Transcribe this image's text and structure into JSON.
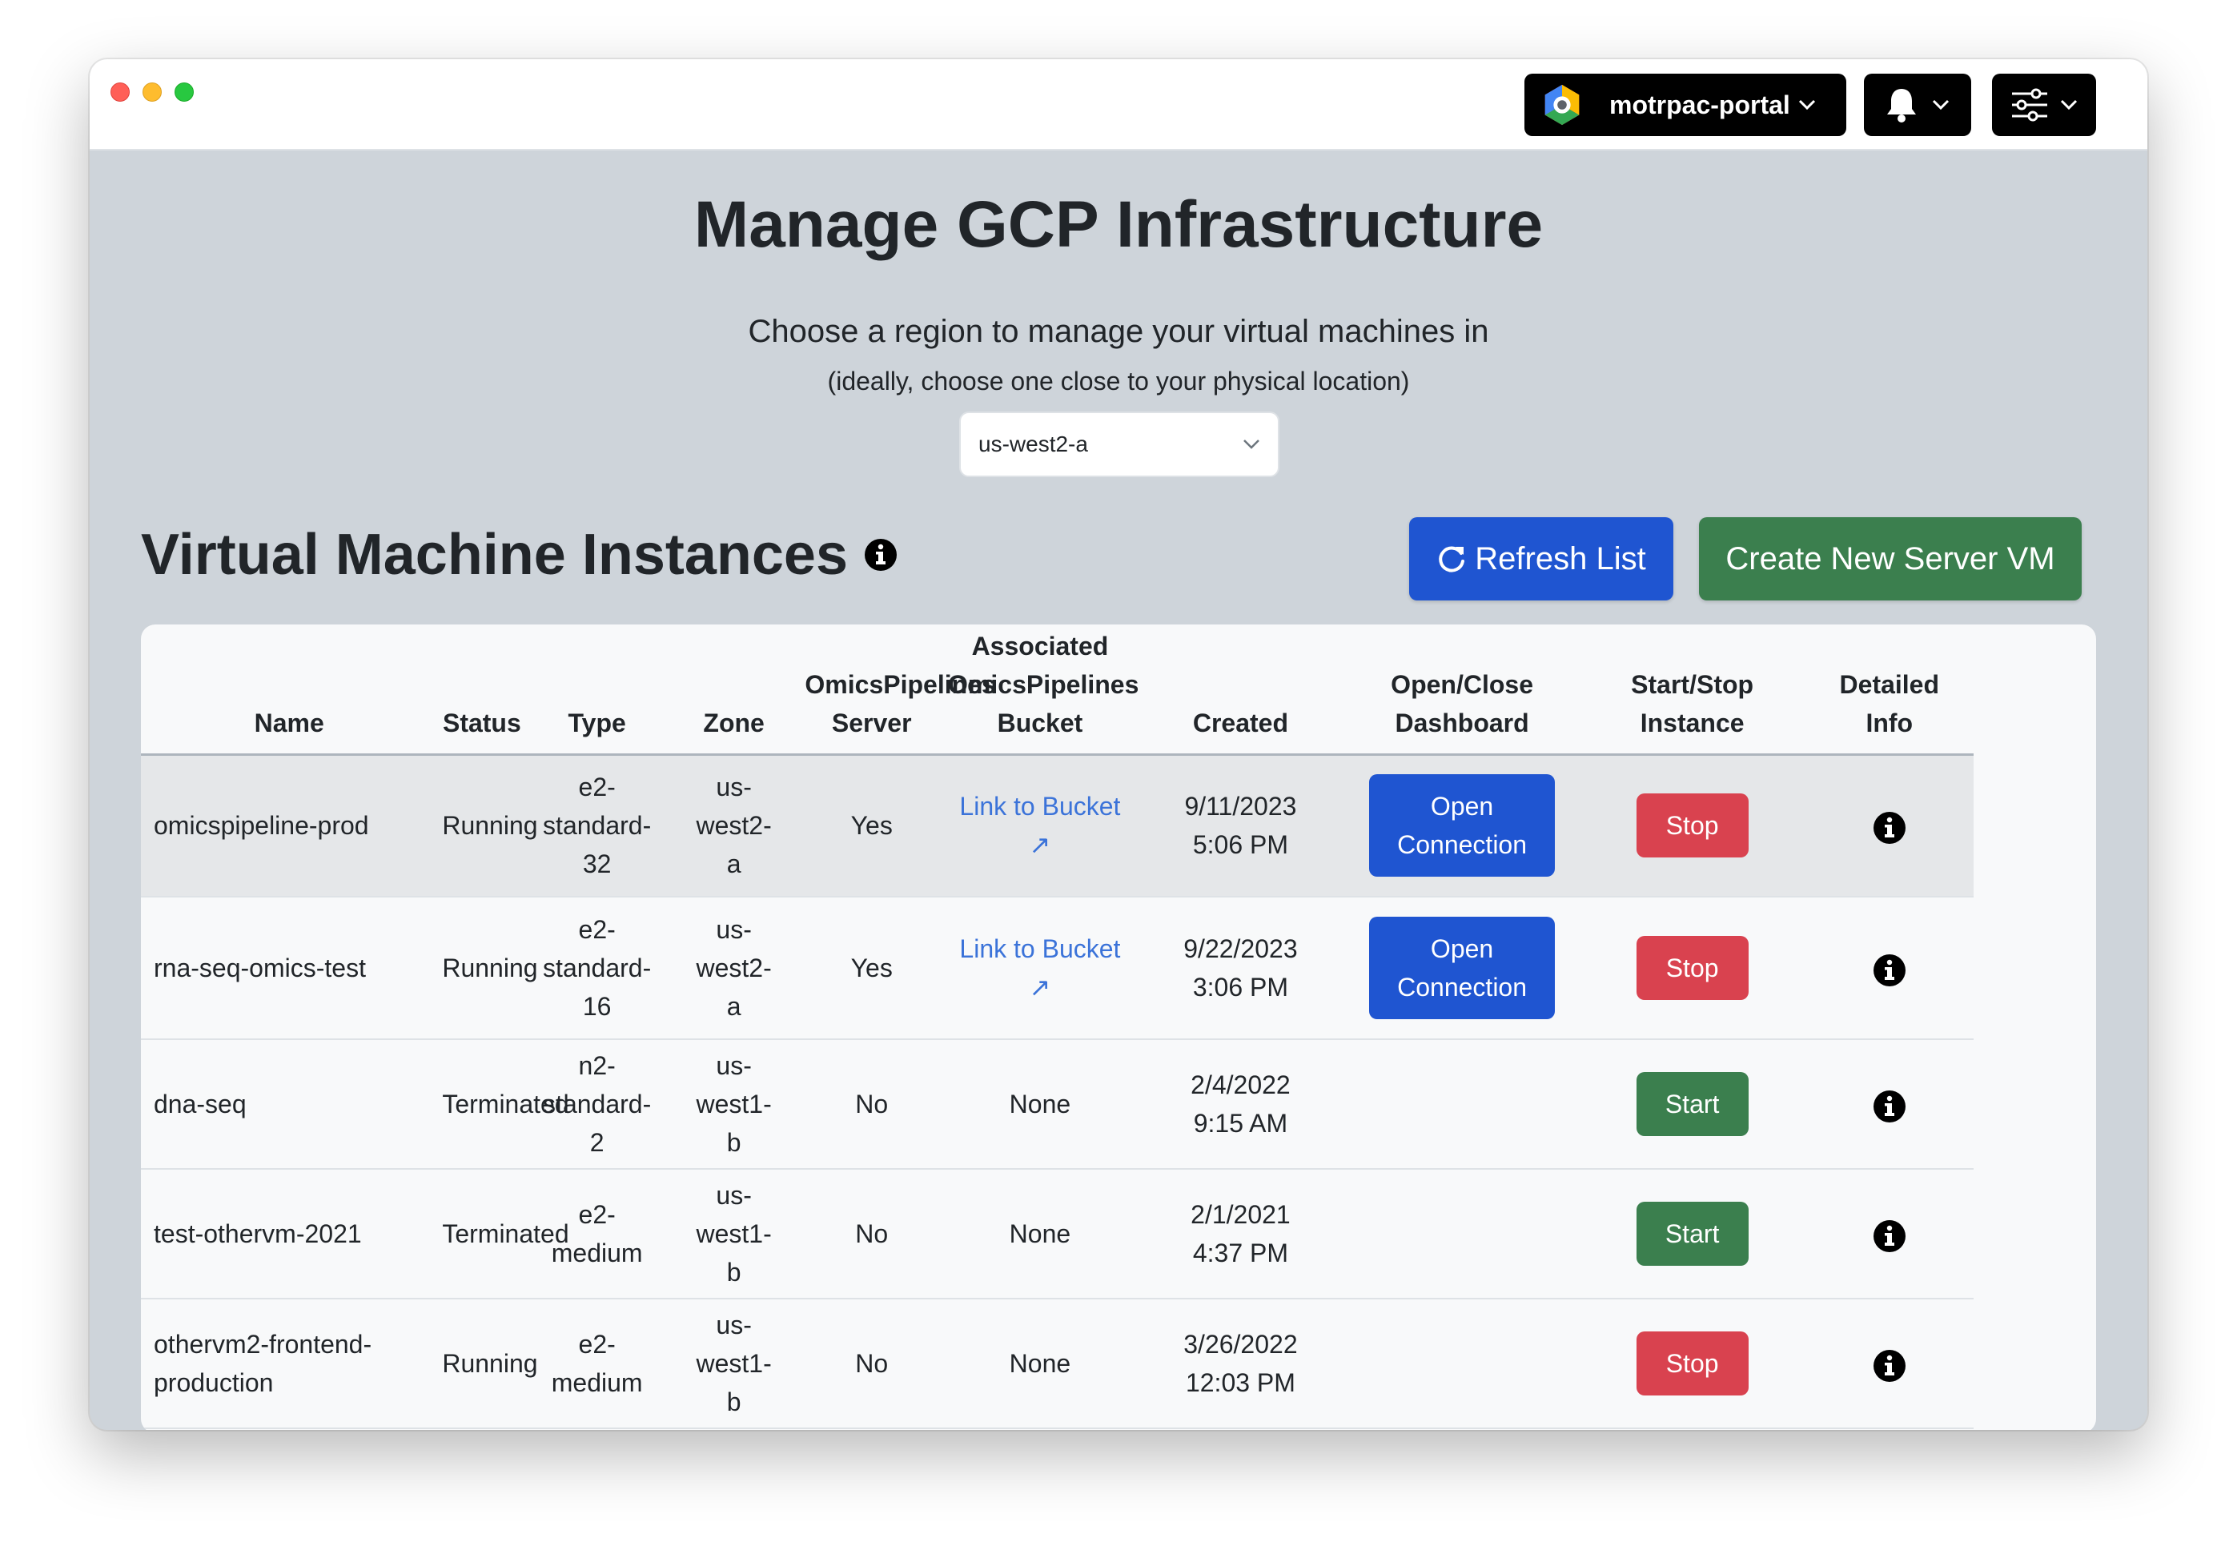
{
  "header": {
    "project_name": "motrpac-portal",
    "icons": [
      "gcp-logo-icon",
      "bell-icon",
      "sliders-icon",
      "chevron-down-icon"
    ]
  },
  "page": {
    "title": "Manage GCP Infrastructure",
    "region_prompt": "Choose a region to manage your virtual machines in",
    "region_hint": "(ideally, choose one close to your physical location)",
    "region_selected": "us-west2-a"
  },
  "section": {
    "title": "Virtual Machine Instances",
    "refresh_label": "Refresh List",
    "create_label": "Create New Server VM"
  },
  "table": {
    "headers": {
      "name": "Name",
      "status": "Status",
      "type": "Type",
      "zone": "Zone",
      "server_l1": "OmicsPipelines",
      "server_l2": "Server",
      "bucket_l1": "Associated",
      "bucket_l2": "OmicsPipelines",
      "bucket_l3": "Bucket",
      "created": "Created",
      "dash_l1": "Open/Close",
      "dash_l2": "Dashboard",
      "ss_l1": "Start/Stop",
      "ss_l2": "Instance",
      "info_l1": "Detailed",
      "info_l2": "Info"
    },
    "rows": [
      {
        "name": "omicspipeline-prod",
        "status": "Running",
        "type_l1": "e2-",
        "type_l2": "standard-",
        "type_l3": "32",
        "zone_l1": "us-",
        "zone_l2": "west2-",
        "zone_l3": "a",
        "server": "Yes",
        "bucket": "Link to Bucket ↗",
        "created_date": "9/11/2023",
        "created_time": "5:06 PM",
        "dash_l1": "Open",
        "dash_l2": "Connection",
        "action": "Stop",
        "action_color": "#d9424f"
      },
      {
        "name": "rna-seq-omics-test",
        "status": "Running",
        "type_l1": "e2-",
        "type_l2": "standard-",
        "type_l3": "16",
        "zone_l1": "us-",
        "zone_l2": "west2-",
        "zone_l3": "a",
        "server": "Yes",
        "bucket": "Link to Bucket ↗",
        "created_date": "9/22/2023",
        "created_time": "3:06 PM",
        "dash_l1": "Open",
        "dash_l2": "Connection",
        "action": "Stop",
        "action_color": "#d9424f"
      },
      {
        "name": "dna-seq",
        "status": "Terminated",
        "type_l1": "n2-",
        "type_l2": "standard-",
        "type_l3": "2",
        "zone_l1": "us-",
        "zone_l2": "west1-",
        "zone_l3": "b",
        "server": "No",
        "bucket": "None",
        "created_date": "2/4/2022",
        "created_time": "9:15 AM",
        "action": "Start",
        "action_color": "#3b7f4e"
      },
      {
        "name": "test-othervm-2021",
        "status": "Terminated",
        "type_l1": "e2-",
        "type_l2": "medium",
        "zone_l1": "us-",
        "zone_l2": "west1-",
        "zone_l3": "b",
        "server": "No",
        "bucket": "None",
        "created_date": "2/1/2021",
        "created_time": "4:37 PM",
        "action": "Start",
        "action_color": "#3b7f4e"
      },
      {
        "name": "othervm2-frontend-production",
        "status": "Running",
        "type_l1": "e2-",
        "type_l2": "medium",
        "zone_l1": "us-",
        "zone_l2": "west1-",
        "zone_l3": "b",
        "server": "No",
        "bucket": "None",
        "created_date": "3/26/2022",
        "created_time": "12:03 PM",
        "action": "Stop",
        "action_color": "#d9424f"
      }
    ]
  }
}
